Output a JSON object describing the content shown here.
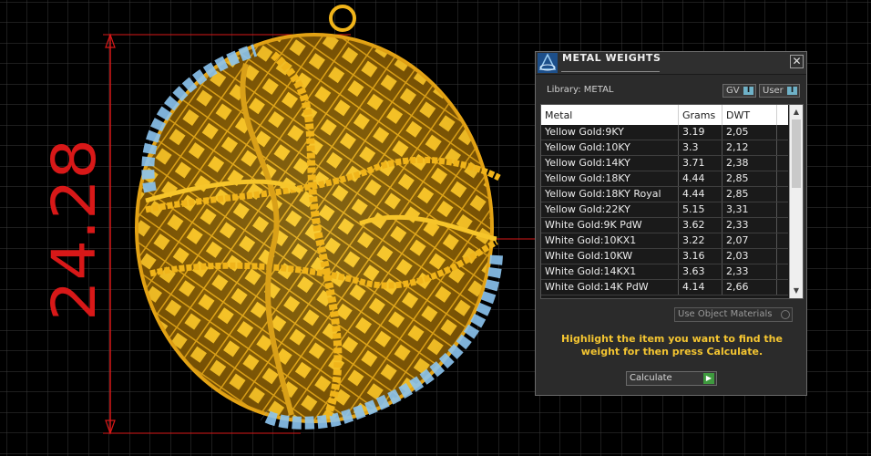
{
  "viewport": {
    "dimension_value": "24.28",
    "colors": {
      "background": "#000000",
      "grid": "#3a3a3a",
      "dimension": "#d81818",
      "gold": "#f2bf22",
      "gem": "#8cc4f0"
    }
  },
  "panel": {
    "title": "METAL WEIGHTS",
    "close_label": "✕",
    "library_label": "Library: METAL",
    "gv_label": "GV",
    "gv_toggle": "I",
    "user_label": "User",
    "user_toggle": "I",
    "columns": [
      "Metal",
      "Grams",
      "DWT"
    ],
    "rows": [
      {
        "metal": "Yellow Gold:9KY",
        "grams": "3.19",
        "dwt": "2,05"
      },
      {
        "metal": "Yellow Gold:10KY",
        "grams": "3.3",
        "dwt": "2,12"
      },
      {
        "metal": "Yellow Gold:14KY",
        "grams": "3.71",
        "dwt": "2,38"
      },
      {
        "metal": "Yellow Gold:18KY",
        "grams": "4.44",
        "dwt": "2,85"
      },
      {
        "metal": "Yellow Gold:18KY Royal",
        "grams": "4.44",
        "dwt": "2,85"
      },
      {
        "metal": "Yellow Gold:22KY",
        "grams": "5.15",
        "dwt": "3,31"
      },
      {
        "metal": "White Gold:9K PdW",
        "grams": "3.62",
        "dwt": "2,33"
      },
      {
        "metal": "White Gold:10KX1",
        "grams": "3.22",
        "dwt": "2,07"
      },
      {
        "metal": "White Gold:10KW",
        "grams": "3.16",
        "dwt": "2,03"
      },
      {
        "metal": "White Gold:14KX1",
        "grams": "3.63",
        "dwt": "2,33"
      },
      {
        "metal": "White Gold:14K PdW",
        "grams": "4.14",
        "dwt": "2,66"
      }
    ],
    "use_object_materials": "Use Object Materials",
    "instructions": "Highlight the item you want to find the weight for then press Calculate.",
    "calculate_label": "Calculate",
    "scroll_up": "▲",
    "scroll_down": "▼",
    "calc_arrow": "▶"
  }
}
